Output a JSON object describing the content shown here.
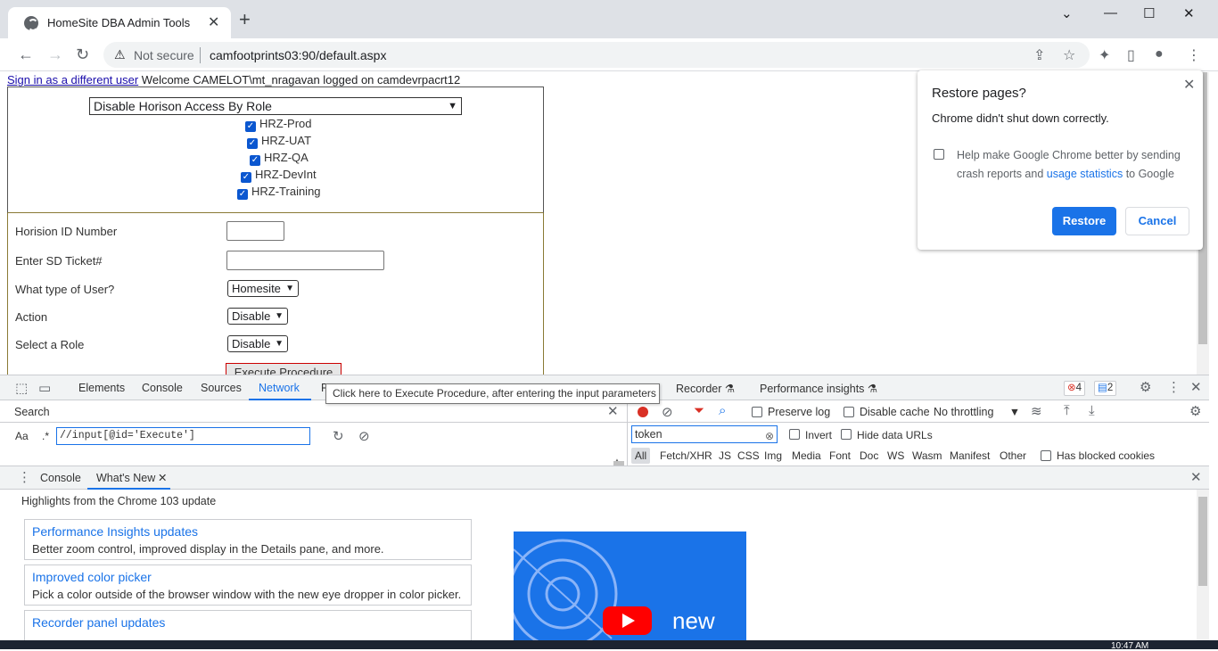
{
  "browser": {
    "tab_title": "HomeSite DBA Admin Tools",
    "tab_close": "✕",
    "new_tab": "+",
    "not_secure": "Not secure",
    "url": "camfootprints03:90/default.aspx",
    "window": {
      "minimize": "⌄",
      "min": "—",
      "max": "☐",
      "close": "✕"
    }
  },
  "page": {
    "sign_in_link": "Sign in as a different user",
    "welcome": " Welcome CAMELOT\\mt_nragavan logged on camdevrpacrt12",
    "role_select": "Disable Horison Access By Role",
    "checkboxes": [
      "HRZ-Prod",
      "HRZ-UAT",
      "HRZ-QA",
      "HRZ-DevInt",
      "HRZ-Training"
    ],
    "form": {
      "horizon_id_label": "Horision ID Number",
      "sd_ticket_label": "Enter SD Ticket#",
      "user_type_label": "What type of User?",
      "user_type_value": "Homesite",
      "action_label": "Action",
      "action_value": "Disable",
      "role_label": "Select a Role",
      "role_value": "Disable",
      "execute_button": "Execute Procedure"
    }
  },
  "restore_popup": {
    "title": "Restore pages?",
    "message": "Chrome didn't shut down correctly.",
    "help_pre": "Help make Google Chrome better by sending crash reports and ",
    "help_link": "usage statistics",
    "help_post": " to Google",
    "restore": "Restore",
    "cancel": "Cancel"
  },
  "devtools": {
    "tabs": [
      "Elements",
      "Console",
      "Sources",
      "Network",
      "P",
      "Recorder",
      "Performance insights"
    ],
    "active_tab": "Network",
    "tooltip": "Click here to Execute Procedure, after entering the input parameters",
    "errors": "4",
    "messages": "2",
    "search_title": "Search",
    "search_aa": "Aa",
    "search_regex": ".*",
    "search_query": "//input[@id='Execute']",
    "preserve_log": "Preserve log",
    "disable_cache": "Disable cache",
    "throttling": "No throttling",
    "filter_value": "token",
    "invert": "Invert",
    "hide_data_urls": "Hide data URLs",
    "types": [
      "All",
      "Fetch/XHR",
      "JS",
      "CSS",
      "Img",
      "Media",
      "Font",
      "Doc",
      "WS",
      "Wasm",
      "Manifest",
      "Other"
    ],
    "has_blocked_cookies": "Has blocked cookies",
    "drawer_tabs": [
      "Console",
      "What's New"
    ],
    "highlights": "Highlights from the Chrome 103 update",
    "cards": [
      {
        "title": "Performance Insights updates",
        "desc": "Better zoom control, improved display in the Details pane, and more."
      },
      {
        "title": "Improved color picker",
        "desc": "Pick a color outside of the browser window with the new eye dropper in color picker."
      },
      {
        "title": "Recorder panel updates",
        "desc": ""
      }
    ],
    "video_text": "new"
  },
  "taskbar": {
    "clock": "10:47 AM"
  },
  "colors": {
    "accent": "#1a73e8",
    "error": "#d93025",
    "checkbox": "#0b57d0"
  }
}
